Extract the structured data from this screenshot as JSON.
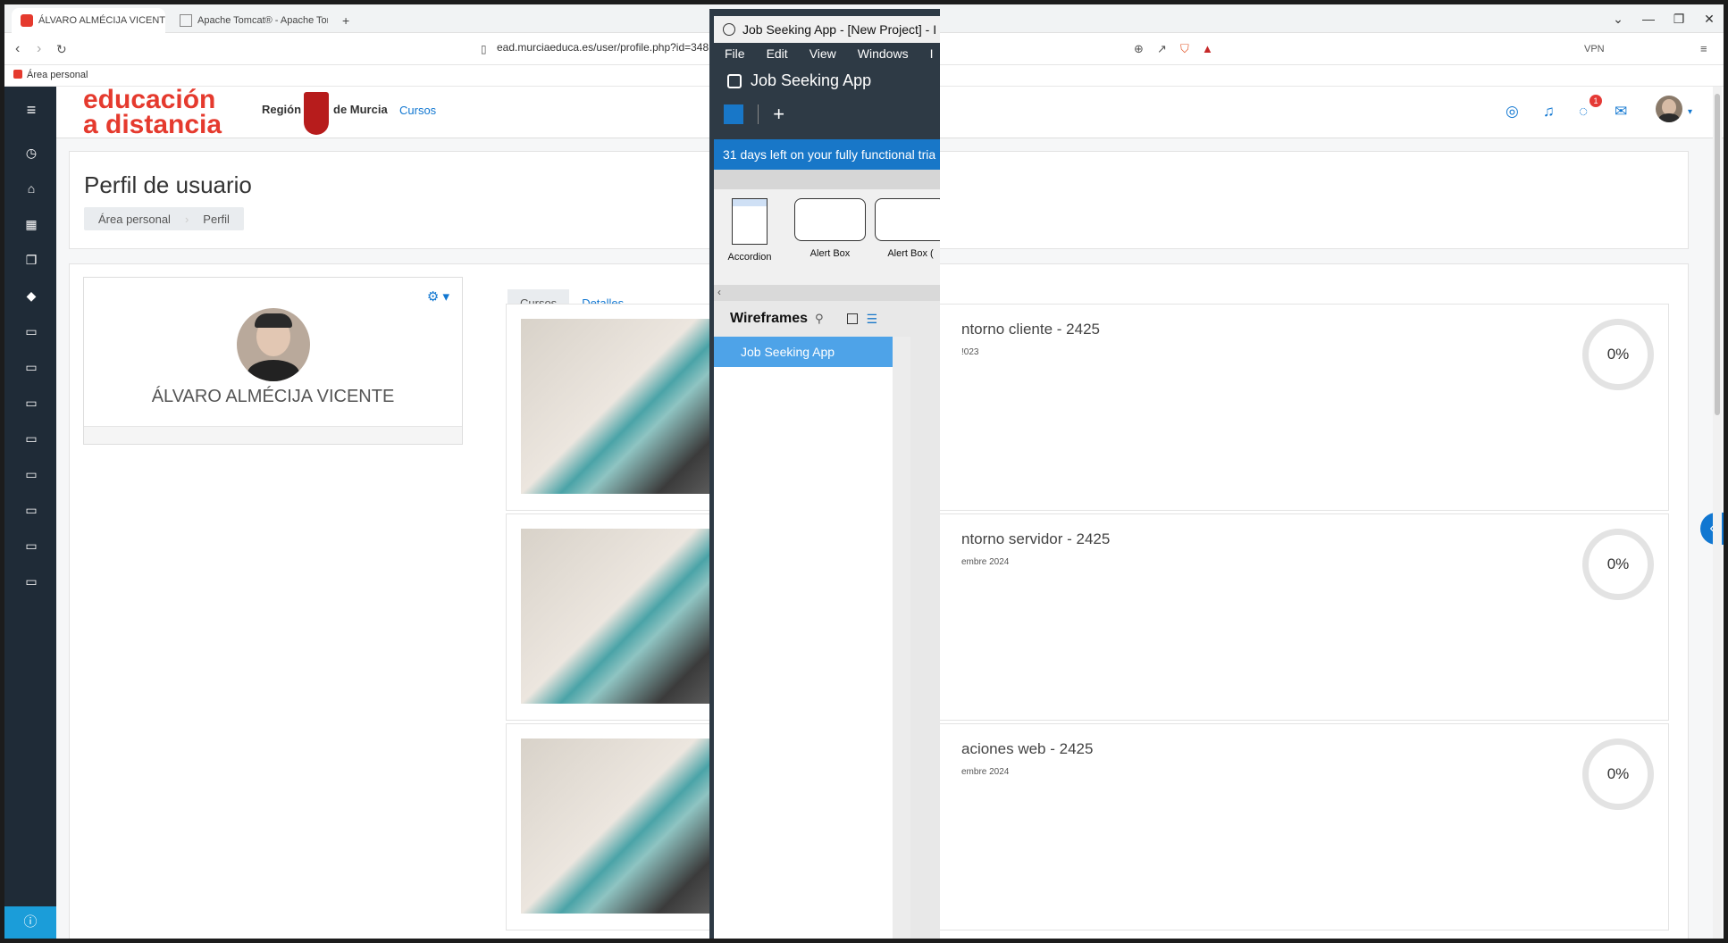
{
  "browser": {
    "tabs": [
      {
        "label": "ÁLVARO ALMÉCIJA VICENTE: Pe",
        "active": true
      },
      {
        "label": "Apache Tomcat® - Apache Tomcat",
        "active": false
      }
    ],
    "new_tab": "+",
    "url": "ead.murciaeduca.es/user/profile.php?id=348",
    "bookmark": "Área personal",
    "vpn_label": "VPN",
    "window_controls": [
      "⌄",
      "—",
      "❐",
      "✕"
    ]
  },
  "site": {
    "logo_line1": "educación",
    "logo_line2": "a distancia",
    "region_label": "Región",
    "region_label2": "de Murcia",
    "nav_cursos": "Cursos",
    "messages_badge": "1",
    "accent": "#1177d1"
  },
  "profile": {
    "page_title": "Perfil de usuario",
    "breadcrumb": [
      "Área personal",
      "Perfil"
    ],
    "user_name": "ÁLVARO ALMÉCIJA VICENTE",
    "tabs": [
      "Cursos",
      "Detalles"
    ]
  },
  "courses": [
    {
      "title": "ntorno cliente - 2425",
      "date": "!023",
      "progress": "0%"
    },
    {
      "title": "ntorno servidor - 2425",
      "date": "embre 2024",
      "progress": "0%"
    },
    {
      "title": "aciones web - 2425",
      "date": "embre 2024",
      "progress": "0%"
    }
  ],
  "app": {
    "window_title": "Job Seeking App - [New Project] - I",
    "menu": [
      "File",
      "Edit",
      "View",
      "Windows",
      "I"
    ],
    "project_name": "Job Seeking App",
    "trial_text": "31 days left on your fully functional tria",
    "palette": [
      "Accordion",
      "Alert Box",
      "Alert Box ("
    ],
    "wireframes_label": "Wireframes",
    "wireframe_item": "Job Seeking App",
    "trial_color": "#1877c8"
  }
}
